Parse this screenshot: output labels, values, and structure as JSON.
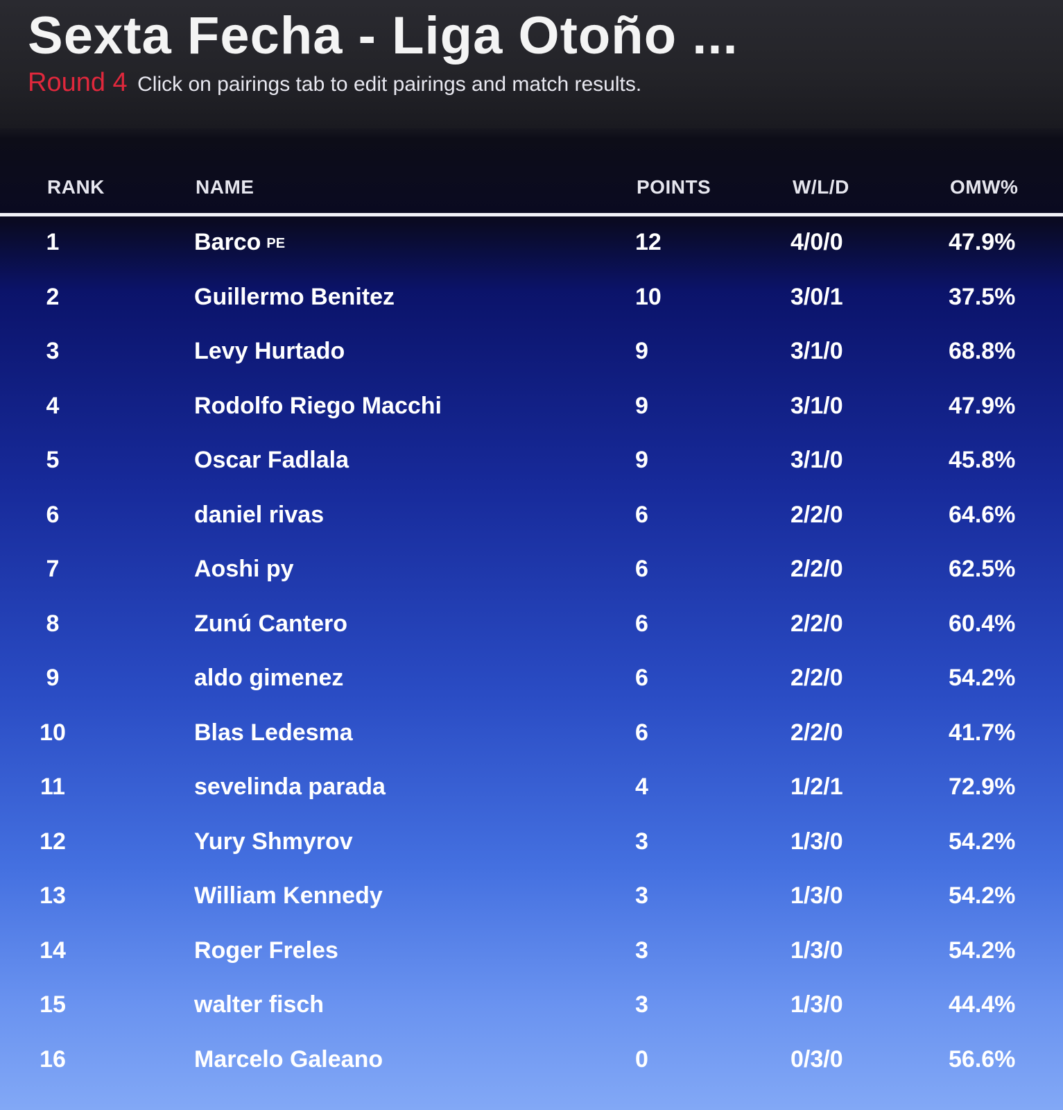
{
  "header": {
    "title": "Sexta Fecha - Liga Otoño ...",
    "round_label": "Round 4",
    "hint": "Click on pairings tab to edit pairings and match results."
  },
  "table": {
    "columns": [
      "RANK",
      "NAME",
      "POINTS",
      "W/L/D",
      "OMW%"
    ],
    "rows": [
      {
        "rank": "1",
        "name": "Barco",
        "flag": "PE",
        "points": "12",
        "wld": "4/0/0",
        "omw": "47.9%"
      },
      {
        "rank": "2",
        "name": "Guillermo Benitez",
        "flag": "",
        "points": "10",
        "wld": "3/0/1",
        "omw": "37.5%"
      },
      {
        "rank": "3",
        "name": "Levy Hurtado",
        "flag": "",
        "points": "9",
        "wld": "3/1/0",
        "omw": "68.8%"
      },
      {
        "rank": "4",
        "name": "Rodolfo Riego Macchi",
        "flag": "",
        "points": "9",
        "wld": "3/1/0",
        "omw": "47.9%"
      },
      {
        "rank": "5",
        "name": "Oscar Fadlala",
        "flag": "",
        "points": "9",
        "wld": "3/1/0",
        "omw": "45.8%"
      },
      {
        "rank": "6",
        "name": "daniel rivas",
        "flag": "",
        "points": "6",
        "wld": "2/2/0",
        "omw": "64.6%"
      },
      {
        "rank": "7",
        "name": "Aoshi py",
        "flag": "",
        "points": "6",
        "wld": "2/2/0",
        "omw": "62.5%"
      },
      {
        "rank": "8",
        "name": "Zunú Cantero",
        "flag": "",
        "points": "6",
        "wld": "2/2/0",
        "omw": "60.4%"
      },
      {
        "rank": "9",
        "name": "aldo gimenez",
        "flag": "",
        "points": "6",
        "wld": "2/2/0",
        "omw": "54.2%"
      },
      {
        "rank": "10",
        "name": "Blas Ledesma",
        "flag": "",
        "points": "6",
        "wld": "2/2/0",
        "omw": "41.7%"
      },
      {
        "rank": "11",
        "name": "sevelinda parada",
        "flag": "",
        "points": "4",
        "wld": "1/2/1",
        "omw": "72.9%"
      },
      {
        "rank": "12",
        "name": "Yury Shmyrov",
        "flag": "",
        "points": "3",
        "wld": "1/3/0",
        "omw": "54.2%"
      },
      {
        "rank": "13",
        "name": "William Kennedy",
        "flag": "",
        "points": "3",
        "wld": "1/3/0",
        "omw": "54.2%"
      },
      {
        "rank": "14",
        "name": "Roger Freles",
        "flag": "",
        "points": "3",
        "wld": "1/3/0",
        "omw": "54.2%"
      },
      {
        "rank": "15",
        "name": "walter fisch",
        "flag": "",
        "points": "3",
        "wld": "1/3/0",
        "omw": "44.4%"
      },
      {
        "rank": "16",
        "name": "Marcelo Galeano",
        "flag": "",
        "points": "0",
        "wld": "0/3/0",
        "omw": "56.6%"
      }
    ]
  },
  "colors": {
    "round_label": "#e0283c",
    "header_bg": "#232328",
    "table_gradient_top": "#0b136a",
    "table_gradient_bottom": "#82a8f6"
  }
}
